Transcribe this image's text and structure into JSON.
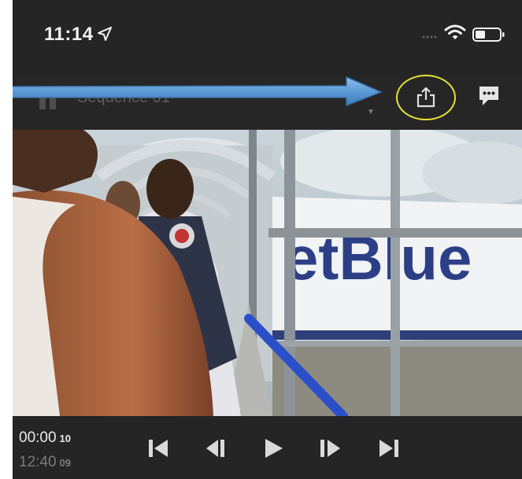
{
  "status_bar": {
    "time": "11:14"
  },
  "header": {
    "sequence_title": "Sequence 01"
  },
  "video": {
    "visible_text": "etBlue"
  },
  "playback": {
    "current_time": "00:00",
    "current_frames": "10",
    "total_time": "12:40",
    "total_frames": "09"
  },
  "colors": {
    "highlight_circle": "#e6e233",
    "annotation_arrow": "#5b9bd5",
    "background": "#232323"
  },
  "icons": [
    "location-arrow-icon",
    "signal-icon",
    "wifi-icon",
    "battery-icon",
    "back-icon",
    "chevron-down-icon",
    "share-icon",
    "comments-icon",
    "skip-to-start-icon",
    "step-back-icon",
    "play-icon",
    "step-forward-icon",
    "skip-to-end-icon"
  ]
}
